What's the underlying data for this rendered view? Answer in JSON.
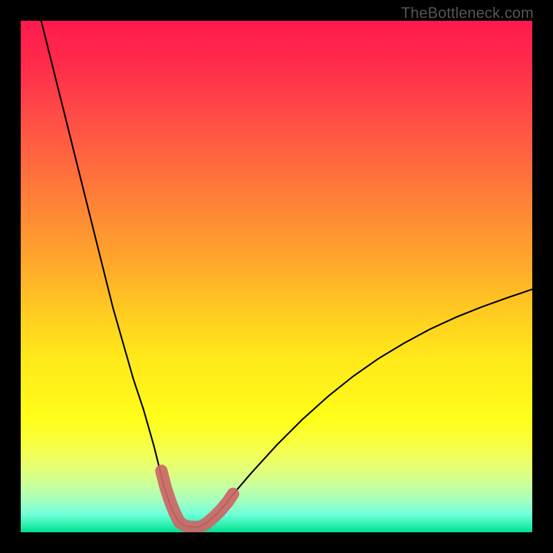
{
  "attribution": "TheBottleneck.com",
  "colors": {
    "frame": "#000000",
    "curve": "#000000",
    "marker": "#cc6666",
    "gradient_top": "#ff1a4d",
    "gradient_mid": "#ffe91a",
    "gradient_bottom": "#00e090"
  },
  "chart_data": {
    "type": "line",
    "title": "",
    "xlabel": "",
    "ylabel": "",
    "xlim": [
      0,
      100
    ],
    "ylim": [
      0,
      100
    ],
    "grid": false,
    "legend": false,
    "series": [
      {
        "name": "bottleneck-curve",
        "x": [
          4,
          6,
          8,
          10,
          12,
          14,
          16,
          18,
          20,
          22,
          24,
          26,
          27,
          28,
          29,
          30,
          31,
          32,
          33,
          34,
          35,
          36,
          38,
          40,
          42,
          45,
          50,
          55,
          60,
          65,
          70,
          75,
          80,
          85,
          90,
          95,
          100
        ],
        "y": [
          100,
          92,
          84,
          76,
          68,
          60,
          52,
          44,
          37,
          30,
          24,
          17,
          13,
          9,
          6,
          3.5,
          2,
          1.3,
          1.1,
          1,
          1.1,
          1.6,
          3.2,
          5.5,
          8,
          11.5,
          17,
          22,
          26.5,
          30.5,
          34,
          37,
          39.7,
          42,
          44,
          45.8,
          47.5
        ]
      }
    ],
    "markers": {
      "name": "highlight-segment",
      "style": "thick-rounded",
      "x": [
        27.5,
        28.4,
        29.3,
        30.2,
        31.0,
        32.0,
        33.0,
        34.0,
        35.0,
        36.0,
        37.0,
        38.0,
        39.0,
        40.5,
        41.5
      ],
      "y": [
        12.0,
        8.5,
        5.8,
        3.6,
        2.0,
        1.3,
        1.05,
        1.0,
        1.05,
        1.5,
        2.3,
        3.2,
        4.2,
        6.0,
        7.5
      ]
    }
  }
}
